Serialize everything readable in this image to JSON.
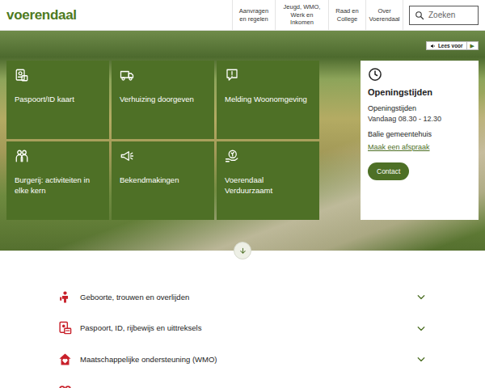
{
  "header": {
    "logo": "voerendaal",
    "nav": [
      "Aanvragen en regelen",
      "Jeugd, WMO, Werk en Inkomen",
      "Raad en College",
      "Over Voerendaal"
    ],
    "search": {
      "placeholder": "Zoeken"
    }
  },
  "read_aloud": {
    "label": "Lees voor",
    "play": "▶"
  },
  "tiles": [
    {
      "label": "Paspoort/ID kaart"
    },
    {
      "label": "Verhuizing doorgeven"
    },
    {
      "label": "Melding Woonomgeving"
    },
    {
      "label": "Burgerij: activiteiten in elke kern"
    },
    {
      "label": "Bekendmakingen"
    },
    {
      "label": "Voerendaal Verduurzaamt"
    }
  ],
  "hours": {
    "title": "Openingstijden",
    "subtitle": "Openingstijden",
    "today": "Vandaag 08.30 - 12.30",
    "counter": "Balie gemeentehuis",
    "link": "Maak een afspraak",
    "button": "Contact"
  },
  "accordion": [
    {
      "label": "Geboorte, trouwen en overlijden",
      "expanded": false
    },
    {
      "label": "Paspoort, ID, rijbewijs en uittreksels",
      "expanded": false
    },
    {
      "label": "Maatschappelijke ondersteuning (WMO)",
      "expanded": false
    }
  ]
}
